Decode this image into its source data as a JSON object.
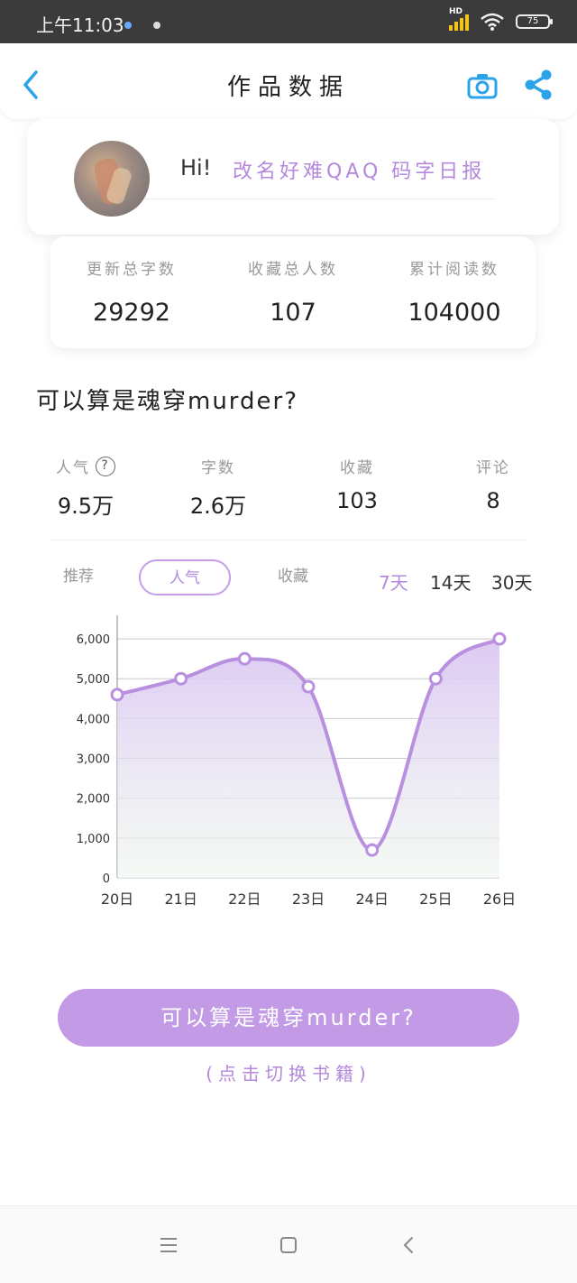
{
  "status_bar": {
    "time": "上午11:03",
    "network": "HD",
    "battery": "75"
  },
  "header": {
    "title": "作品数据"
  },
  "profile": {
    "greeting": "Hi!",
    "report_name": "改名好难QAQ 码字日报"
  },
  "stats": [
    {
      "label": "更新总字数",
      "value": "29292"
    },
    {
      "label": "收藏总人数",
      "value": "107"
    },
    {
      "label": "累计阅读数",
      "value": "104000"
    }
  ],
  "book": {
    "title": "可以算是魂穿murder?"
  },
  "metrics": [
    {
      "label": "人气",
      "value": "9.5万"
    },
    {
      "label": "字数",
      "value": "2.6万"
    },
    {
      "label": "收藏",
      "value": "103"
    },
    {
      "label": "评论",
      "value": "8"
    }
  ],
  "help_icon_glyph": "?",
  "tabs": [
    {
      "label": "推荐",
      "active": false
    },
    {
      "label": "人气",
      "active": true
    },
    {
      "label": "收藏",
      "active": false
    }
  ],
  "ranges": [
    {
      "label": "7天",
      "active": true
    },
    {
      "label": "14天",
      "active": false
    },
    {
      "label": "30天",
      "active": false
    }
  ],
  "chart_data": {
    "type": "area",
    "x": [
      "20日",
      "21日",
      "22日",
      "23日",
      "24日",
      "25日",
      "26日"
    ],
    "series": [
      {
        "values": [
          4600,
          5000,
          5500,
          4800,
          700,
          5000,
          6000
        ]
      }
    ],
    "yticks": [
      "0",
      "1,000",
      "2,000",
      "3,000",
      "4,000",
      "5,000",
      "6,000"
    ],
    "ylim": [
      0,
      6500
    ],
    "grid": true,
    "line_color": "#b98fe0",
    "fill_color": "#d9c4f2"
  },
  "switch_button": {
    "label": "可以算是魂穿murder?",
    "hint": "(点击切换书籍)"
  },
  "colors": {
    "accent": "#b388dd",
    "button": "#c29ae6",
    "blue": "#2aa3e8"
  }
}
